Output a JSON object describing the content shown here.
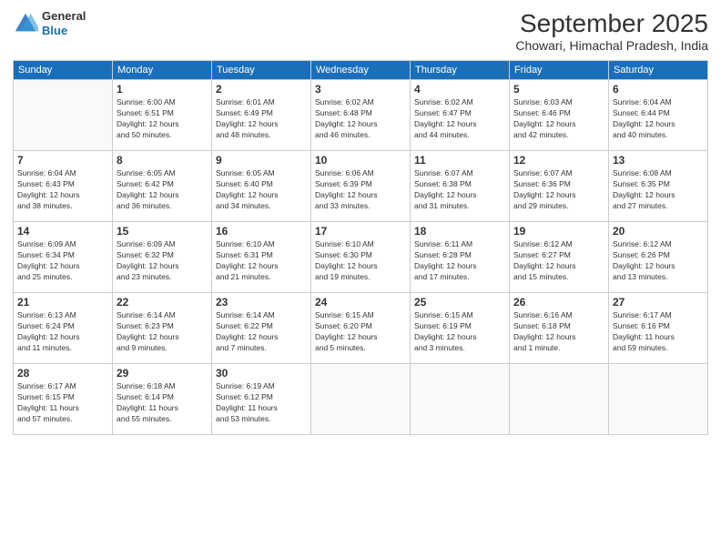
{
  "header": {
    "logo_line1": "General",
    "logo_line2": "Blue",
    "main_title": "September 2025",
    "subtitle": "Chowari, Himachal Pradesh, India"
  },
  "days_of_week": [
    "Sunday",
    "Monday",
    "Tuesday",
    "Wednesday",
    "Thursday",
    "Friday",
    "Saturday"
  ],
  "weeks": [
    [
      {
        "day": "",
        "info": ""
      },
      {
        "day": "1",
        "info": "Sunrise: 6:00 AM\nSunset: 6:51 PM\nDaylight: 12 hours\nand 50 minutes."
      },
      {
        "day": "2",
        "info": "Sunrise: 6:01 AM\nSunset: 6:49 PM\nDaylight: 12 hours\nand 48 minutes."
      },
      {
        "day": "3",
        "info": "Sunrise: 6:02 AM\nSunset: 6:48 PM\nDaylight: 12 hours\nand 46 minutes."
      },
      {
        "day": "4",
        "info": "Sunrise: 6:02 AM\nSunset: 6:47 PM\nDaylight: 12 hours\nand 44 minutes."
      },
      {
        "day": "5",
        "info": "Sunrise: 6:03 AM\nSunset: 6:46 PM\nDaylight: 12 hours\nand 42 minutes."
      },
      {
        "day": "6",
        "info": "Sunrise: 6:04 AM\nSunset: 6:44 PM\nDaylight: 12 hours\nand 40 minutes."
      }
    ],
    [
      {
        "day": "7",
        "info": "Sunrise: 6:04 AM\nSunset: 6:43 PM\nDaylight: 12 hours\nand 38 minutes."
      },
      {
        "day": "8",
        "info": "Sunrise: 6:05 AM\nSunset: 6:42 PM\nDaylight: 12 hours\nand 36 minutes."
      },
      {
        "day": "9",
        "info": "Sunrise: 6:05 AM\nSunset: 6:40 PM\nDaylight: 12 hours\nand 34 minutes."
      },
      {
        "day": "10",
        "info": "Sunrise: 6:06 AM\nSunset: 6:39 PM\nDaylight: 12 hours\nand 33 minutes."
      },
      {
        "day": "11",
        "info": "Sunrise: 6:07 AM\nSunset: 6:38 PM\nDaylight: 12 hours\nand 31 minutes."
      },
      {
        "day": "12",
        "info": "Sunrise: 6:07 AM\nSunset: 6:36 PM\nDaylight: 12 hours\nand 29 minutes."
      },
      {
        "day": "13",
        "info": "Sunrise: 6:08 AM\nSunset: 6:35 PM\nDaylight: 12 hours\nand 27 minutes."
      }
    ],
    [
      {
        "day": "14",
        "info": "Sunrise: 6:09 AM\nSunset: 6:34 PM\nDaylight: 12 hours\nand 25 minutes."
      },
      {
        "day": "15",
        "info": "Sunrise: 6:09 AM\nSunset: 6:32 PM\nDaylight: 12 hours\nand 23 minutes."
      },
      {
        "day": "16",
        "info": "Sunrise: 6:10 AM\nSunset: 6:31 PM\nDaylight: 12 hours\nand 21 minutes."
      },
      {
        "day": "17",
        "info": "Sunrise: 6:10 AM\nSunset: 6:30 PM\nDaylight: 12 hours\nand 19 minutes."
      },
      {
        "day": "18",
        "info": "Sunrise: 6:11 AM\nSunset: 6:28 PM\nDaylight: 12 hours\nand 17 minutes."
      },
      {
        "day": "19",
        "info": "Sunrise: 6:12 AM\nSunset: 6:27 PM\nDaylight: 12 hours\nand 15 minutes."
      },
      {
        "day": "20",
        "info": "Sunrise: 6:12 AM\nSunset: 6:26 PM\nDaylight: 12 hours\nand 13 minutes."
      }
    ],
    [
      {
        "day": "21",
        "info": "Sunrise: 6:13 AM\nSunset: 6:24 PM\nDaylight: 12 hours\nand 11 minutes."
      },
      {
        "day": "22",
        "info": "Sunrise: 6:14 AM\nSunset: 6:23 PM\nDaylight: 12 hours\nand 9 minutes."
      },
      {
        "day": "23",
        "info": "Sunrise: 6:14 AM\nSunset: 6:22 PM\nDaylight: 12 hours\nand 7 minutes."
      },
      {
        "day": "24",
        "info": "Sunrise: 6:15 AM\nSunset: 6:20 PM\nDaylight: 12 hours\nand 5 minutes."
      },
      {
        "day": "25",
        "info": "Sunrise: 6:15 AM\nSunset: 6:19 PM\nDaylight: 12 hours\nand 3 minutes."
      },
      {
        "day": "26",
        "info": "Sunrise: 6:16 AM\nSunset: 6:18 PM\nDaylight: 12 hours\nand 1 minute."
      },
      {
        "day": "27",
        "info": "Sunrise: 6:17 AM\nSunset: 6:16 PM\nDaylight: 11 hours\nand 59 minutes."
      }
    ],
    [
      {
        "day": "28",
        "info": "Sunrise: 6:17 AM\nSunset: 6:15 PM\nDaylight: 11 hours\nand 57 minutes."
      },
      {
        "day": "29",
        "info": "Sunrise: 6:18 AM\nSunset: 6:14 PM\nDaylight: 11 hours\nand 55 minutes."
      },
      {
        "day": "30",
        "info": "Sunrise: 6:19 AM\nSunset: 6:12 PM\nDaylight: 11 hours\nand 53 minutes."
      },
      {
        "day": "",
        "info": ""
      },
      {
        "day": "",
        "info": ""
      },
      {
        "day": "",
        "info": ""
      },
      {
        "day": "",
        "info": ""
      }
    ]
  ]
}
